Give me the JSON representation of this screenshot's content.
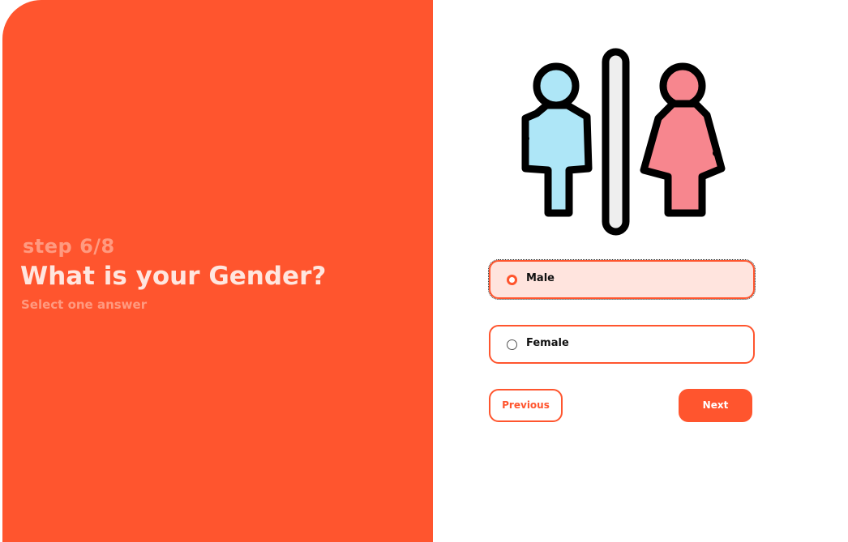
{
  "left": {
    "step": "step 6/8",
    "question": "What is your Gender?",
    "subtitle": "Select one answer"
  },
  "illustration": {
    "icon": "restroom-gender-icon",
    "colors": {
      "male": "#aee6f7",
      "female": "#f7868e",
      "divider": "#eeeeee",
      "outline": "#000000"
    }
  },
  "options": [
    {
      "label": "Male",
      "selected": true
    },
    {
      "label": "Female",
      "selected": false
    }
  ],
  "buttons": {
    "previous": "Previous",
    "next": "Next"
  },
  "theme": {
    "accent": "#ff552e",
    "selected_bg": "#ffe4de"
  }
}
